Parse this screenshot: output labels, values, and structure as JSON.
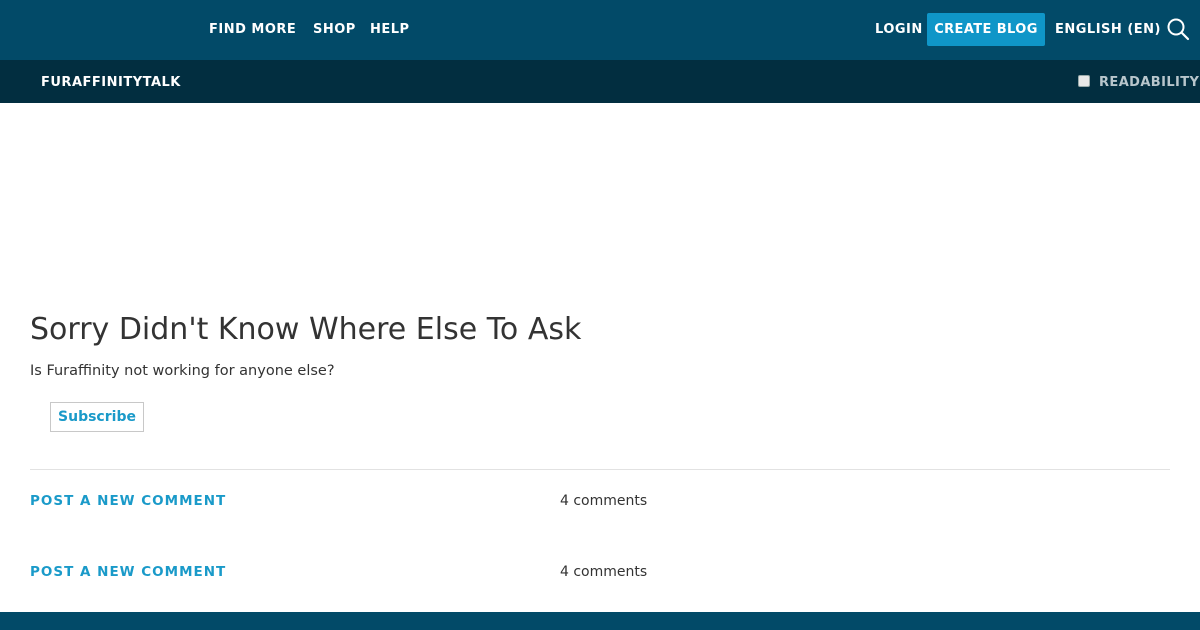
{
  "header": {
    "nav": [
      "FIND MORE",
      "SHOP",
      "HELP"
    ],
    "login": "LOGIN",
    "create_blog": "CREATE BLOG",
    "language": "ENGLISH (EN)",
    "search_icon": "search-icon"
  },
  "subheader": {
    "blog_name": "FURAFFINITYTALK",
    "readability": "READABILITY",
    "readability_checked": false
  },
  "post": {
    "title": "Sorry Didn't Know Where Else To Ask",
    "body": "Is Furaffinity not working for anyone else?",
    "subscribe": "Subscribe"
  },
  "comments": [
    {
      "link": "POST A NEW COMMENT",
      "count": "4 comments"
    },
    {
      "link": "POST A NEW COMMENT",
      "count": "4 comments"
    }
  ],
  "colors": {
    "topbar": "#024a68",
    "subbar": "#022e40",
    "accent": "#1a9ac9",
    "button": "#0f96c8"
  }
}
